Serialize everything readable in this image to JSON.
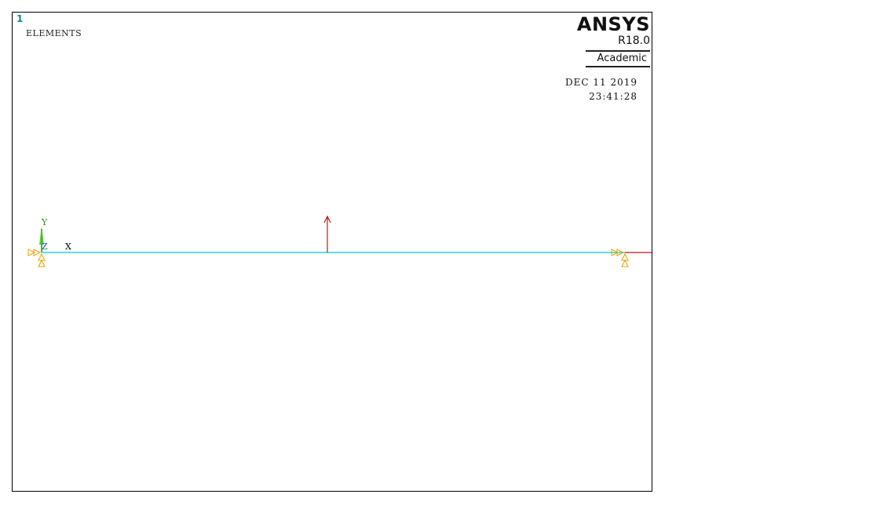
{
  "window": {
    "number": "1",
    "label": "ELEMENTS"
  },
  "branding": {
    "product": "ANSYS",
    "release": "R18.0",
    "license": "Academic"
  },
  "timestamp": {
    "date": "DEC 11 2019",
    "time": "23:41:28"
  },
  "triad": {
    "y_label": "Y",
    "z_label": "Z",
    "x_label": "X"
  },
  "colors": {
    "element": "#00c8d8",
    "force": "#d01010",
    "support": "#e8a000",
    "triad_y": "#40c020",
    "triad_x": "#000000"
  }
}
